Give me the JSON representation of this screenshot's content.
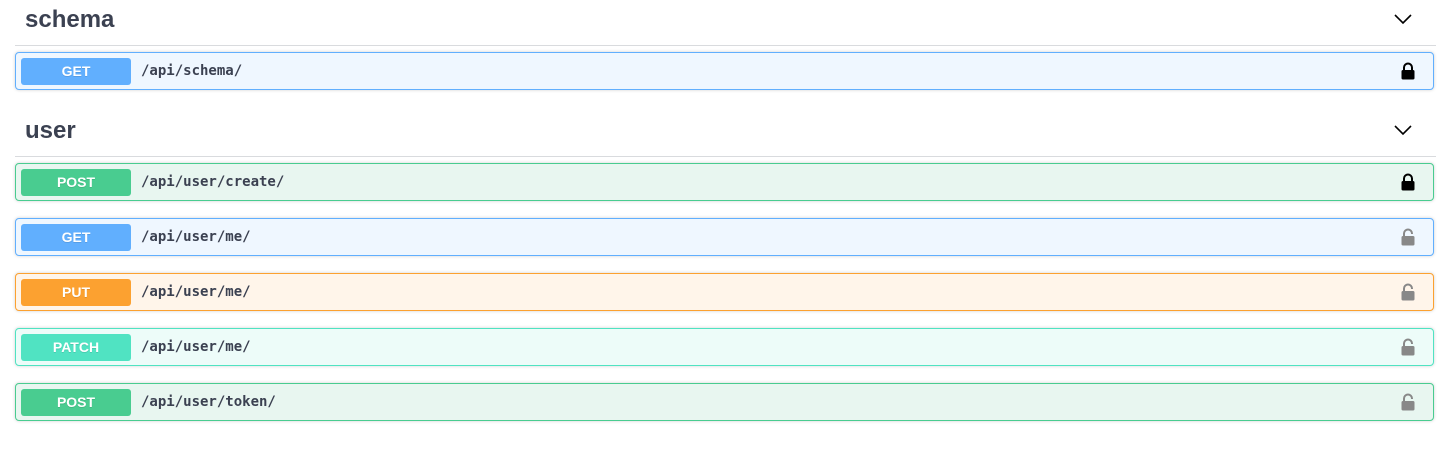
{
  "colors": {
    "get": "#61affe",
    "get_bg": "#eff7ff",
    "post": "#49cc90",
    "post_bg": "#e8f6f0",
    "put": "#fca130",
    "put_bg": "#fff5ea",
    "patch": "#50e3c2",
    "patch_bg": "#edfcf9",
    "lock_locked": "#000000",
    "lock_unlocked": "#888888"
  },
  "sections": [
    {
      "title": "schema",
      "chevron_icon": "chevron-down-icon",
      "operations": [
        {
          "method": "GET",
          "path": "/api/schema/",
          "lock": "locked"
        }
      ]
    },
    {
      "title": "user",
      "chevron_icon": "chevron-down-icon",
      "operations": [
        {
          "method": "POST",
          "path": "/api/user/create/",
          "lock": "locked"
        },
        {
          "method": "GET",
          "path": "/api/user/me/",
          "lock": "unlocked"
        },
        {
          "method": "PUT",
          "path": "/api/user/me/",
          "lock": "unlocked"
        },
        {
          "method": "PATCH",
          "path": "/api/user/me/",
          "lock": "unlocked"
        },
        {
          "method": "POST",
          "path": "/api/user/token/",
          "lock": "unlocked"
        }
      ]
    }
  ]
}
